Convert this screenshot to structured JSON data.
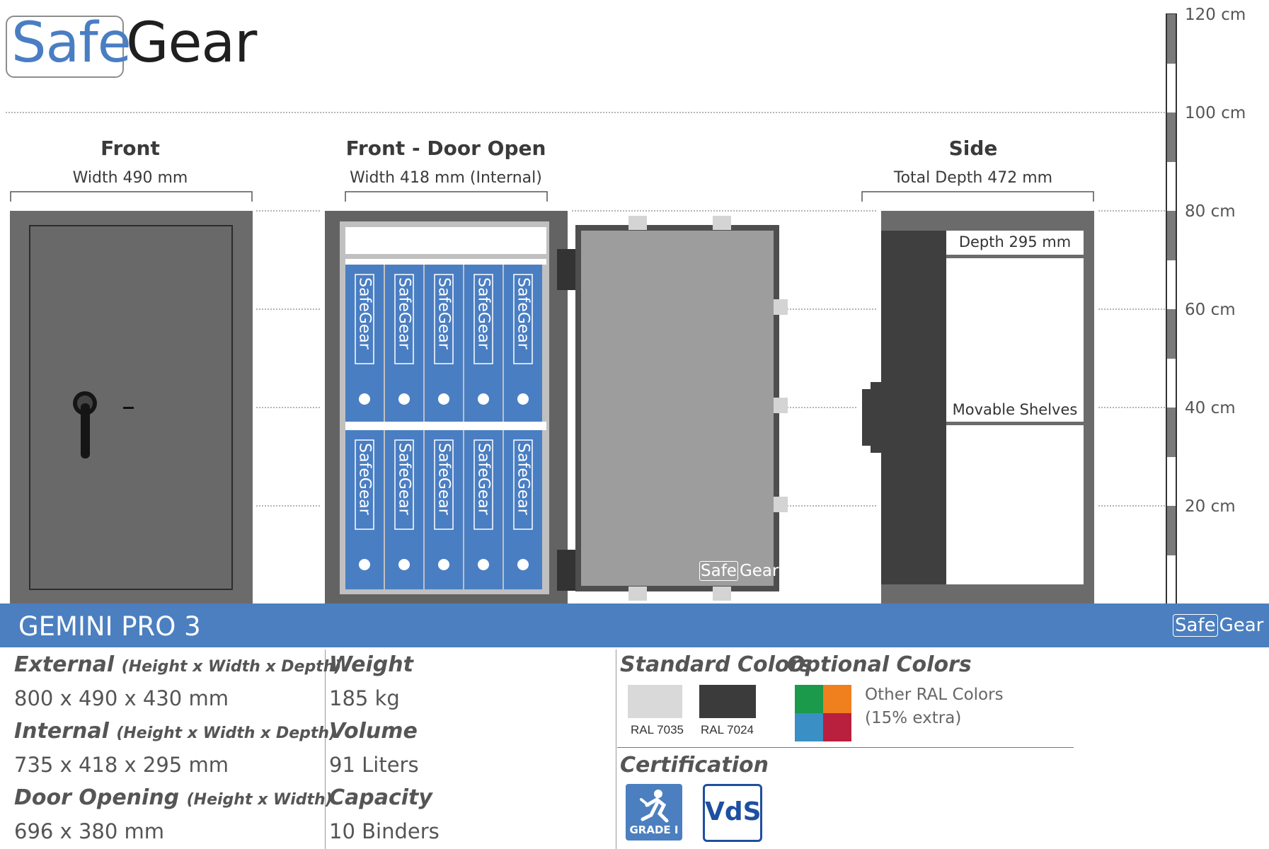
{
  "brand": {
    "safe": "Safe",
    "gear": "Gear"
  },
  "views": {
    "front": {
      "title": "Front",
      "dimension": "Width 490 mm"
    },
    "door_open": {
      "title": "Front - Door Open",
      "dimension": "Width 418 mm (Internal)"
    },
    "side": {
      "title": "Side",
      "dimension": "Total Depth 472 mm"
    }
  },
  "scale_ticks": [
    "120 cm",
    "100 cm",
    "80 cm",
    "60 cm",
    "40 cm",
    "20 cm"
  ],
  "binder_label": {
    "safe": "Safe",
    "gear": "Gear"
  },
  "door_logo": {
    "safe": "Safe",
    "gear": "Gear"
  },
  "side_labels": {
    "depth": "Depth 295 mm",
    "shelves": "Movable Shelves"
  },
  "banner": {
    "model": "GEMINI PRO 3",
    "logo_safe": "Safe",
    "logo_gear": "Gear"
  },
  "specs": {
    "external_label": "External",
    "external_note": "(Height x Width x Depth)",
    "external_value": "800 x 490 x 430 mm",
    "internal_label": "Internal",
    "internal_note": "(Height x Width x Depth)",
    "internal_value": "735 x 418 x 295 mm",
    "door_label": "Door Opening",
    "door_note": "(Height x Width)",
    "door_value": "696 x 380 mm",
    "weight_label": "Weight",
    "weight_value": "185 kg",
    "volume_label": "Volume",
    "volume_value": "91 Liters",
    "capacity_label": "Capacity",
    "capacity_value": "10 Binders"
  },
  "colors": {
    "standard_title": "Standard Colors",
    "optional_title": "Optional Colors",
    "ral_7035": "RAL 7035",
    "ral_7035_hex": "#d9d9d9",
    "ral_7024": "RAL 7024",
    "ral_7024_hex": "#3b3b3b",
    "optional_palette": [
      "#1a9a4a",
      "#f07f1d",
      "#3a8fc4",
      "#b8203e"
    ],
    "other_line1": "Other RAL Colors",
    "other_line2": "(15% extra)"
  },
  "certification": {
    "title": "Certification",
    "grade": "GRADE I",
    "vds": "VdS"
  },
  "palette": {
    "accent": "#4b7fc0",
    "body_gray": "#6b6b6b",
    "binder_blue": "#4a7ec3"
  }
}
